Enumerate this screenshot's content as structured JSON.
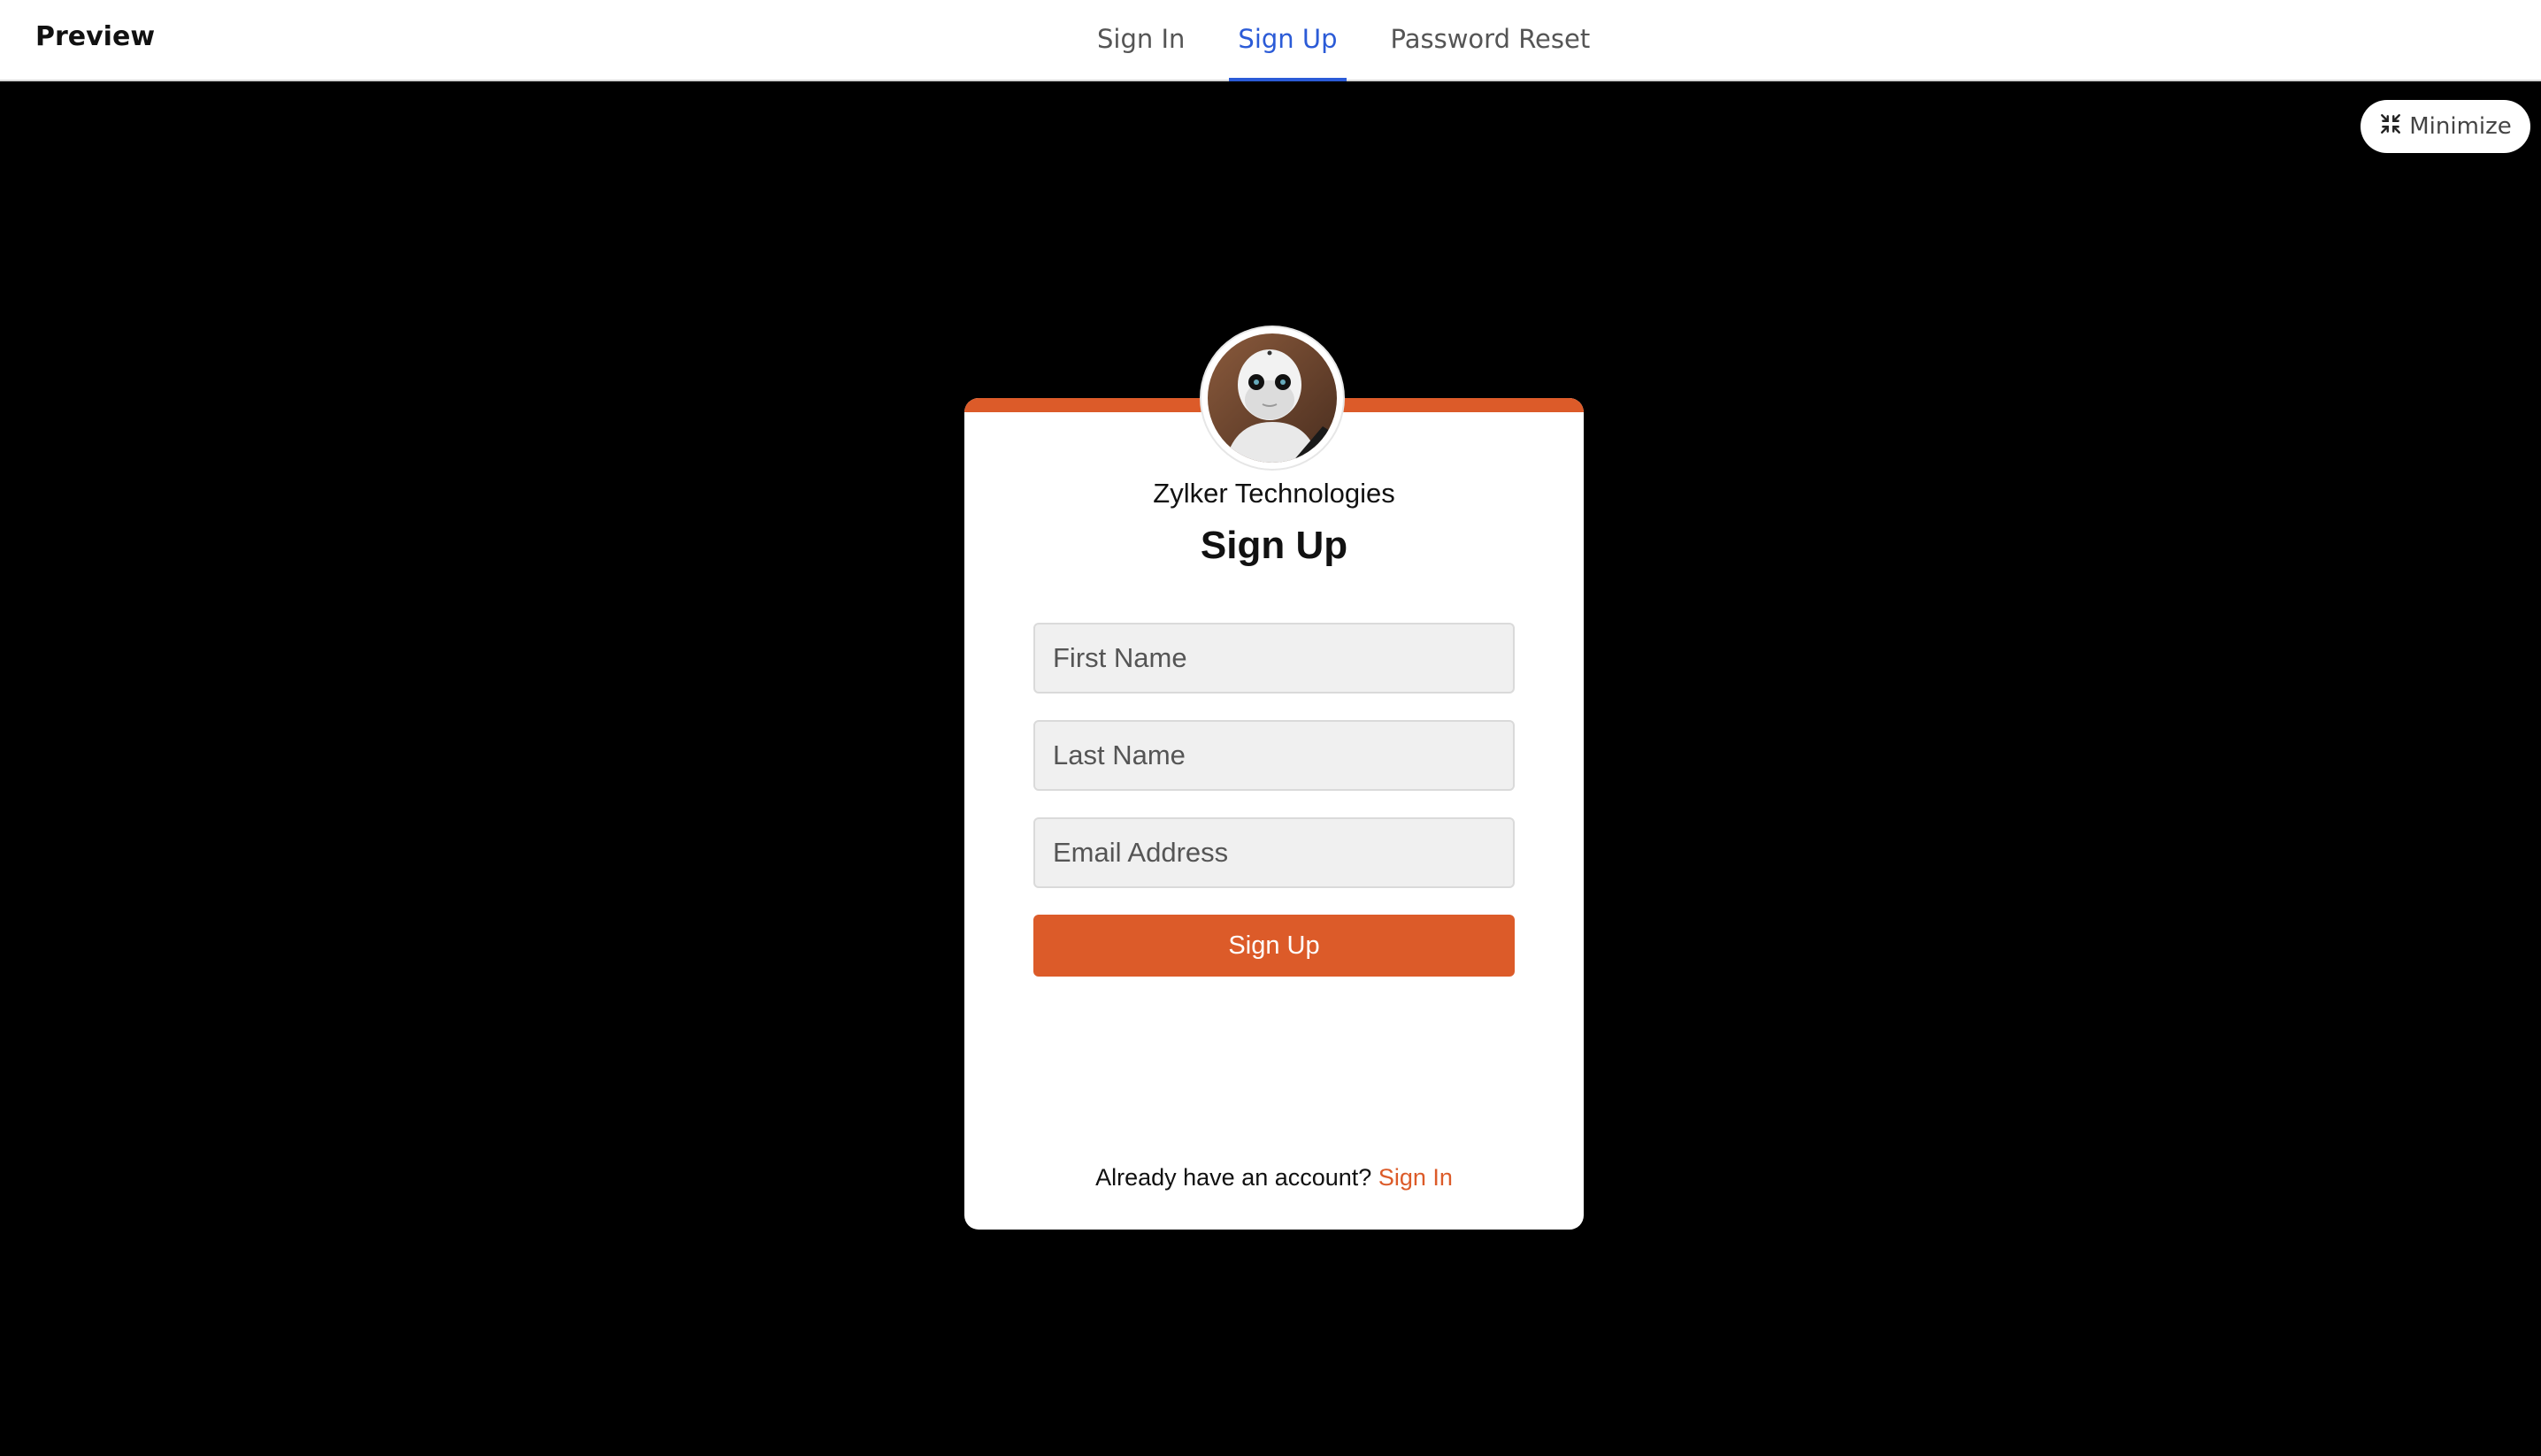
{
  "header": {
    "brand": "Preview",
    "tabs": [
      {
        "label": "Sign In",
        "active": false
      },
      {
        "label": "Sign Up",
        "active": true
      },
      {
        "label": "Password Reset",
        "active": false
      }
    ],
    "active_color": "#2b5bd7"
  },
  "minimize": {
    "label": "Minimize",
    "icon": "minimize-arrows-icon"
  },
  "card": {
    "accent_color": "#dc5b29",
    "avatar_icon": "robot-avatar",
    "company": "Zylker Technologies",
    "title": "Sign Up",
    "fields": [
      {
        "placeholder": "First Name",
        "value": ""
      },
      {
        "placeholder": "Last Name",
        "value": ""
      },
      {
        "placeholder": "Email Address",
        "value": ""
      }
    ],
    "submit_label": "Sign Up",
    "footer_text": "Already have an account?",
    "footer_link": "Sign In"
  }
}
